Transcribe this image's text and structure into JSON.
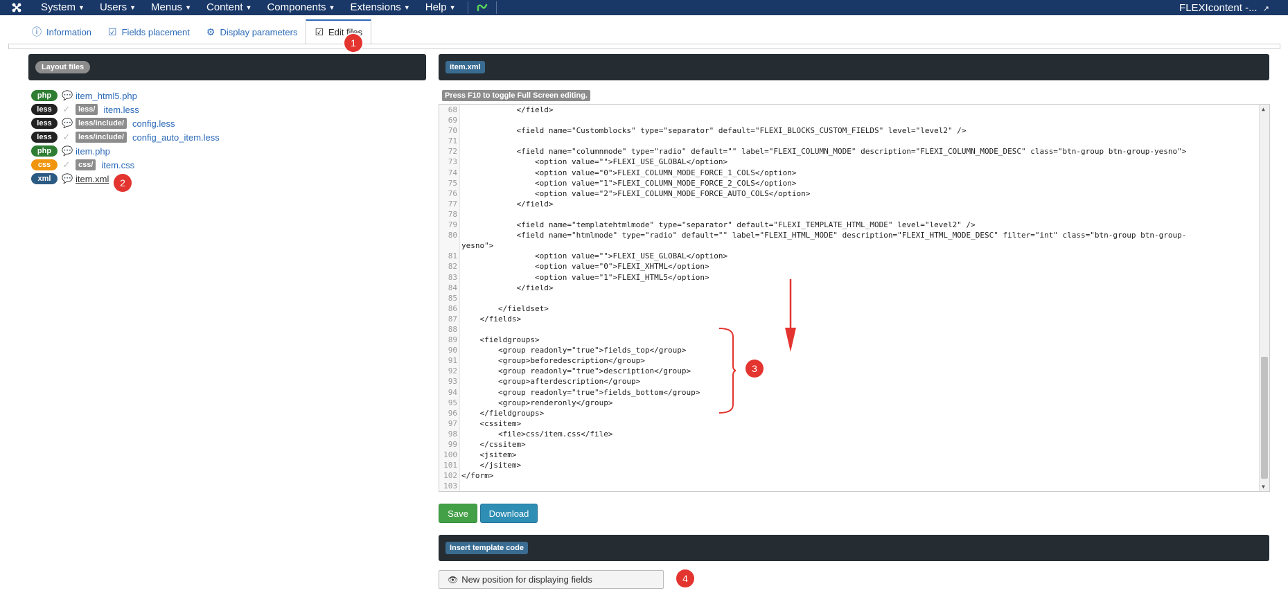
{
  "topbar": {
    "menu": [
      {
        "label": "System"
      },
      {
        "label": "Users"
      },
      {
        "label": "Menus"
      },
      {
        "label": "Content"
      },
      {
        "label": "Components"
      },
      {
        "label": "Extensions"
      },
      {
        "label": "Help"
      }
    ],
    "site_title": "FLEXIcontent -..."
  },
  "tabs": [
    {
      "label": "Information"
    },
    {
      "label": "Fields placement"
    },
    {
      "label": "Display parameters"
    },
    {
      "label": "Edit files"
    }
  ],
  "left_panel": {
    "header": "Layout files",
    "files": [
      {
        "type": "php",
        "dir": "",
        "name": "item_html5.php"
      },
      {
        "type": "less",
        "dir": "less/",
        "name": "item.less"
      },
      {
        "type": "less",
        "dir": "less/include/",
        "name": "config.less"
      },
      {
        "type": "less",
        "dir": "less/include/",
        "name": "config_auto_item.less"
      },
      {
        "type": "php",
        "dir": "",
        "name": "item.php"
      },
      {
        "type": "css",
        "dir": "css/",
        "name": "item.css"
      },
      {
        "type": "xml",
        "dir": "",
        "name": "item.xml"
      }
    ]
  },
  "editor_panel": {
    "header": "item.xml",
    "hint": "Press F10 to toggle Full Screen editing.",
    "lines": [
      {
        "n": "68",
        "t": "            </field>"
      },
      {
        "n": "69",
        "t": ""
      },
      {
        "n": "70",
        "t": "            <field name=\"Customblocks\" type=\"separator\" default=\"FLEXI_BLOCKS_CUSTOM_FIELDS\" level=\"level2\" />"
      },
      {
        "n": "71",
        "t": ""
      },
      {
        "n": "72",
        "t": "            <field name=\"columnmode\" type=\"radio\" default=\"\" label=\"FLEXI_COLUMN_MODE\" description=\"FLEXI_COLUMN_MODE_DESC\" class=\"btn-group btn-group-yesno\">"
      },
      {
        "n": "73",
        "t": "                <option value=\"\">FLEXI_USE_GLOBAL</option>"
      },
      {
        "n": "74",
        "t": "                <option value=\"0\">FLEXI_COLUMN_MODE_FORCE_1_COLS</option>"
      },
      {
        "n": "75",
        "t": "                <option value=\"1\">FLEXI_COLUMN_MODE_FORCE_2_COLS</option>"
      },
      {
        "n": "76",
        "t": "                <option value=\"2\">FLEXI_COLUMN_MODE_FORCE_AUTO_COLS</option>"
      },
      {
        "n": "77",
        "t": "            </field>"
      },
      {
        "n": "78",
        "t": ""
      },
      {
        "n": "79",
        "t": "            <field name=\"templatehtmlmode\" type=\"separator\" default=\"FLEXI_TEMPLATE_HTML_MODE\" level=\"level2\" />"
      },
      {
        "n": "80",
        "t": "            <field name=\"htmlmode\" type=\"radio\" default=\"\" label=\"FLEXI_HTML_MODE\" description=\"FLEXI_HTML_MODE_DESC\" filter=\"int\" class=\"btn-group btn-group-"
      },
      {
        "n": "",
        "t": "yesno\">"
      },
      {
        "n": "81",
        "t": "                <option value=\"\">FLEXI_USE_GLOBAL</option>"
      },
      {
        "n": "82",
        "t": "                <option value=\"0\">FLEXI_XHTML</option>"
      },
      {
        "n": "83",
        "t": "                <option value=\"1\">FLEXI_HTML5</option>"
      },
      {
        "n": "84",
        "t": "            </field>"
      },
      {
        "n": "85",
        "t": ""
      },
      {
        "n": "86",
        "t": "        </fieldset>"
      },
      {
        "n": "87",
        "t": "    </fields>"
      },
      {
        "n": "88",
        "t": ""
      },
      {
        "n": "89",
        "t": "    <fieldgroups>"
      },
      {
        "n": "90",
        "t": "        <group readonly=\"true\">fields_top</group>"
      },
      {
        "n": "91",
        "t": "        <group>beforedescription</group>"
      },
      {
        "n": "92",
        "t": "        <group readonly=\"true\">description</group>"
      },
      {
        "n": "93",
        "t": "        <group>afterdescription</group>"
      },
      {
        "n": "94",
        "t": "        <group readonly=\"true\">fields_bottom</group>"
      },
      {
        "n": "95",
        "t": "        <group>renderonly</group>"
      },
      {
        "n": "96",
        "t": "    </fieldgroups>"
      },
      {
        "n": "97",
        "t": "    <cssitem>"
      },
      {
        "n": "98",
        "t": "        <file>css/item.css</file>"
      },
      {
        "n": "99",
        "t": "    </cssitem>"
      },
      {
        "n": "100",
        "t": "    <jsitem>"
      },
      {
        "n": "101",
        "t": "    </jsitem>"
      },
      {
        "n": "102",
        "t": "</form>"
      },
      {
        "n": "103",
        "t": ""
      }
    ],
    "save_label": "Save",
    "download_label": "Download"
  },
  "insert_panel": {
    "header": "Insert template code",
    "button_label": "New position for displaying fields"
  },
  "callouts": [
    "1",
    "2",
    "3",
    "4"
  ],
  "colors": {
    "navbar": "#1a3867",
    "panel_header": "#252d33",
    "link": "#2a69b8",
    "save": "#43a047",
    "download": "#2f8eb4",
    "callout": "#e3342f"
  }
}
